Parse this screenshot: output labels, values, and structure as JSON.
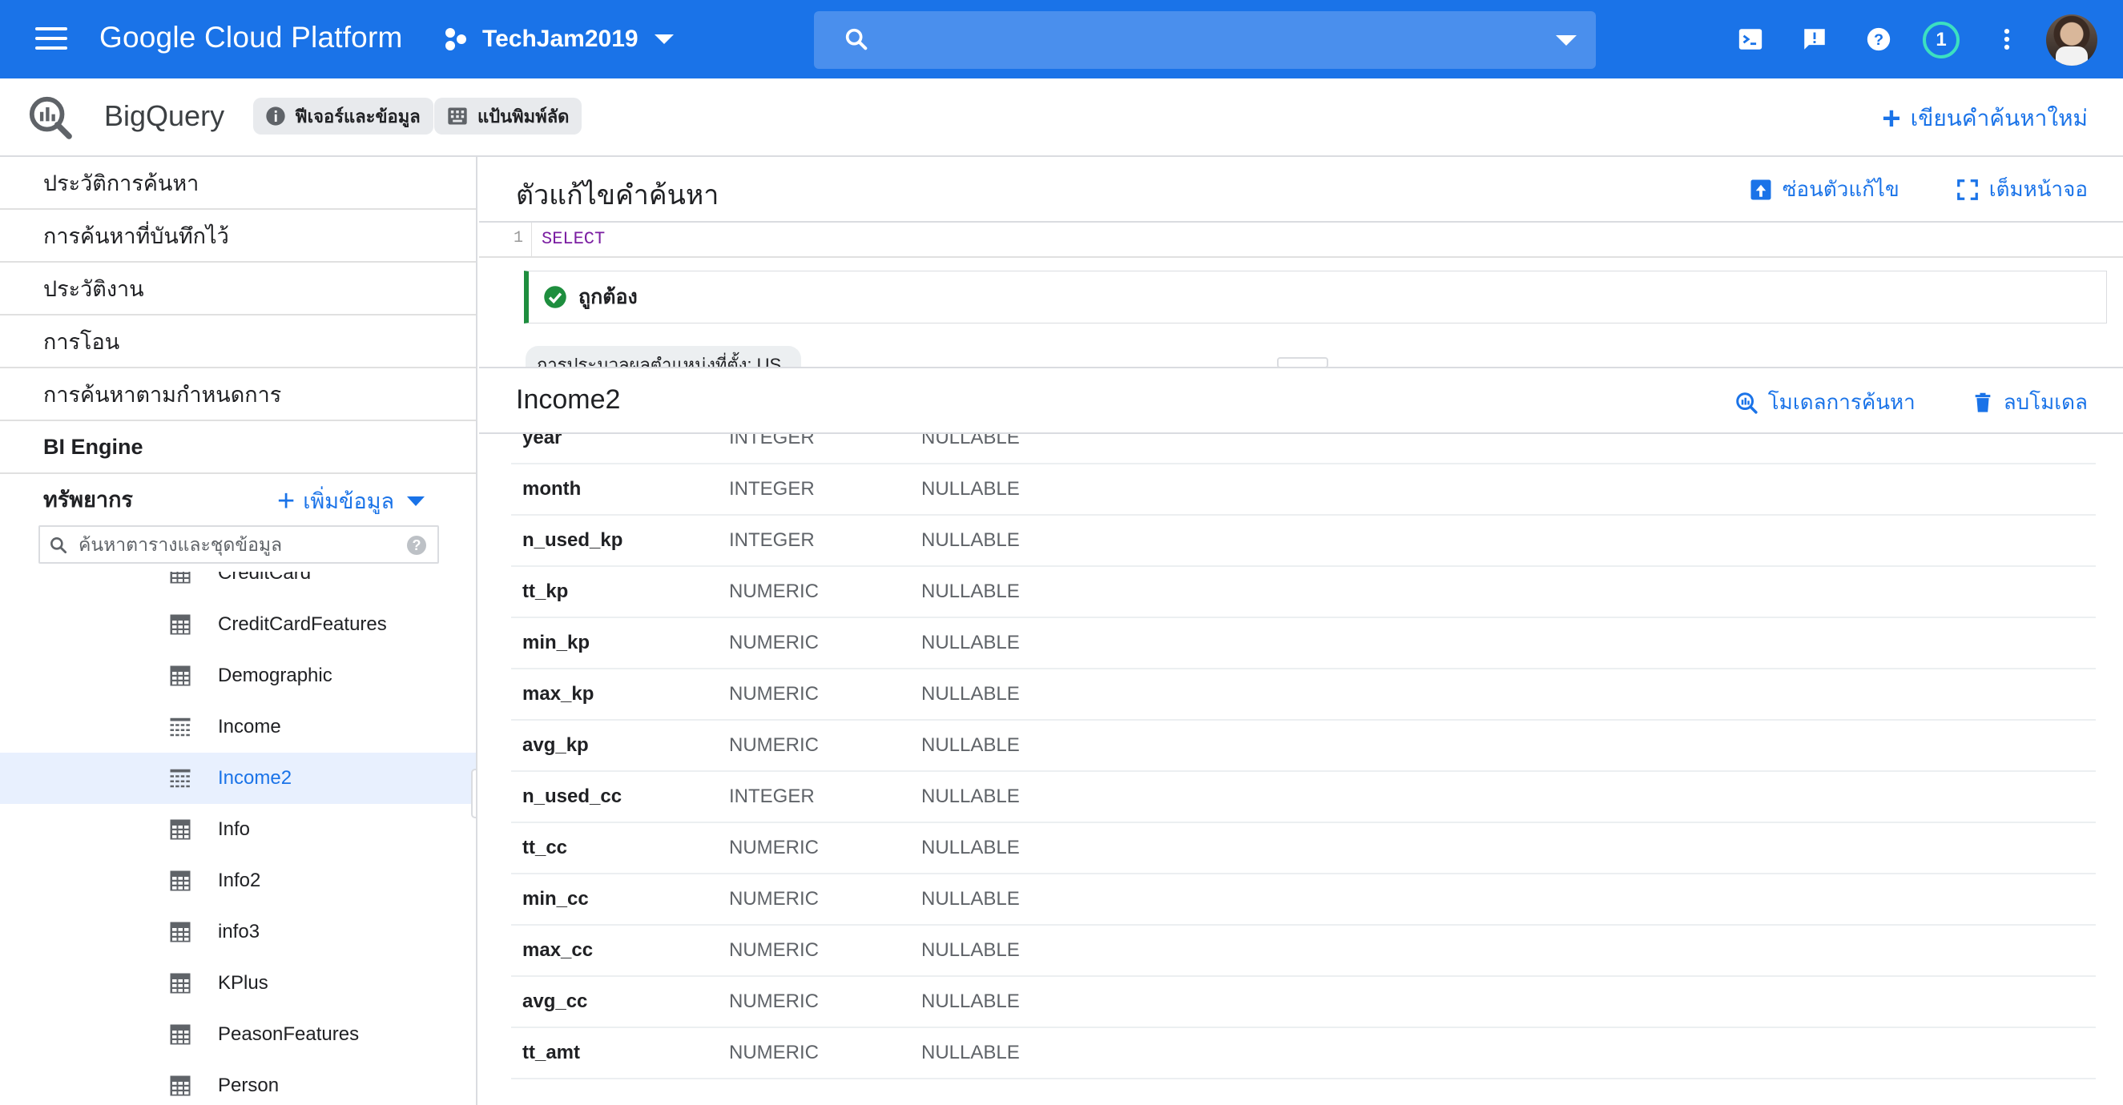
{
  "topbar": {
    "title": "Google Cloud Platform",
    "project": "TechJam2019",
    "notification_count": "1",
    "icons": [
      "menu-icon",
      "project-icon",
      "search-icon",
      "cloud-shell-icon",
      "feedback-icon",
      "help-icon",
      "more-vert-icon"
    ]
  },
  "subbar": {
    "product": "BigQuery",
    "chip_features": "ฟีเจอร์และข้อมูล",
    "chip_shortcuts": "แป้นพิมพ์ลัด",
    "compose": "เขียนคำค้นหาใหม่"
  },
  "sidebar": {
    "nav": [
      {
        "label": "ประวัติการค้นหา"
      },
      {
        "label": "การค้นหาที่บันทึกไว้"
      },
      {
        "label": "ประวัติงาน"
      },
      {
        "label": "การโอน"
      },
      {
        "label": "การค้นหาตามกำหนดการ"
      },
      {
        "label": "BI Engine"
      }
    ],
    "resources_title": "ทรัพยากร",
    "add_data": "เพิ่มข้อมูล",
    "search_placeholder": "ค้นหาตารางและชุดข้อมูล",
    "tree": [
      {
        "label": "CreditCard",
        "icon": "table-icon"
      },
      {
        "label": "CreditCardFeatures",
        "icon": "table-icon"
      },
      {
        "label": "Demographic",
        "icon": "table-icon"
      },
      {
        "label": "Income",
        "icon": "view-table-icon"
      },
      {
        "label": "Income2",
        "icon": "view-table-icon",
        "selected": true
      },
      {
        "label": "Info",
        "icon": "table-icon"
      },
      {
        "label": "Info2",
        "icon": "table-icon"
      },
      {
        "label": "info3",
        "icon": "table-icon"
      },
      {
        "label": "KPlus",
        "icon": "table-icon"
      },
      {
        "label": "PeasonFeatures",
        "icon": "table-icon"
      },
      {
        "label": "Person",
        "icon": "table-icon"
      }
    ]
  },
  "editor": {
    "title": "ตัวแก้ไขคำค้นหา",
    "hide_editor": "ซ่อนตัวแก้ไข",
    "fullscreen": "เต็มหน้าจอ",
    "line_number": "1",
    "code": "SELECT",
    "validation": "ถูกต้อง",
    "location": "การประมวลผลตำแหน่งที่ตั้ง: US"
  },
  "schema": {
    "title": "Income2",
    "query_model": "โมเดลการค้นหา",
    "delete_model": "ลบโมเดล",
    "rows": [
      {
        "name": "year",
        "type": "INTEGER",
        "mode": "NULLABLE"
      },
      {
        "name": "month",
        "type": "INTEGER",
        "mode": "NULLABLE"
      },
      {
        "name": "n_used_kp",
        "type": "INTEGER",
        "mode": "NULLABLE"
      },
      {
        "name": "tt_kp",
        "type": "NUMERIC",
        "mode": "NULLABLE"
      },
      {
        "name": "min_kp",
        "type": "NUMERIC",
        "mode": "NULLABLE"
      },
      {
        "name": "max_kp",
        "type": "NUMERIC",
        "mode": "NULLABLE"
      },
      {
        "name": "avg_kp",
        "type": "NUMERIC",
        "mode": "NULLABLE"
      },
      {
        "name": "n_used_cc",
        "type": "INTEGER",
        "mode": "NULLABLE"
      },
      {
        "name": "tt_cc",
        "type": "NUMERIC",
        "mode": "NULLABLE"
      },
      {
        "name": "min_cc",
        "type": "NUMERIC",
        "mode": "NULLABLE"
      },
      {
        "name": "max_cc",
        "type": "NUMERIC",
        "mode": "NULLABLE"
      },
      {
        "name": "avg_cc",
        "type": "NUMERIC",
        "mode": "NULLABLE"
      },
      {
        "name": "tt_amt",
        "type": "NUMERIC",
        "mode": "NULLABLE"
      }
    ]
  },
  "colors": {
    "primary": "#1a73e8",
    "valid": "#1e8e3e",
    "selected_bg": "#e8f0fe"
  }
}
